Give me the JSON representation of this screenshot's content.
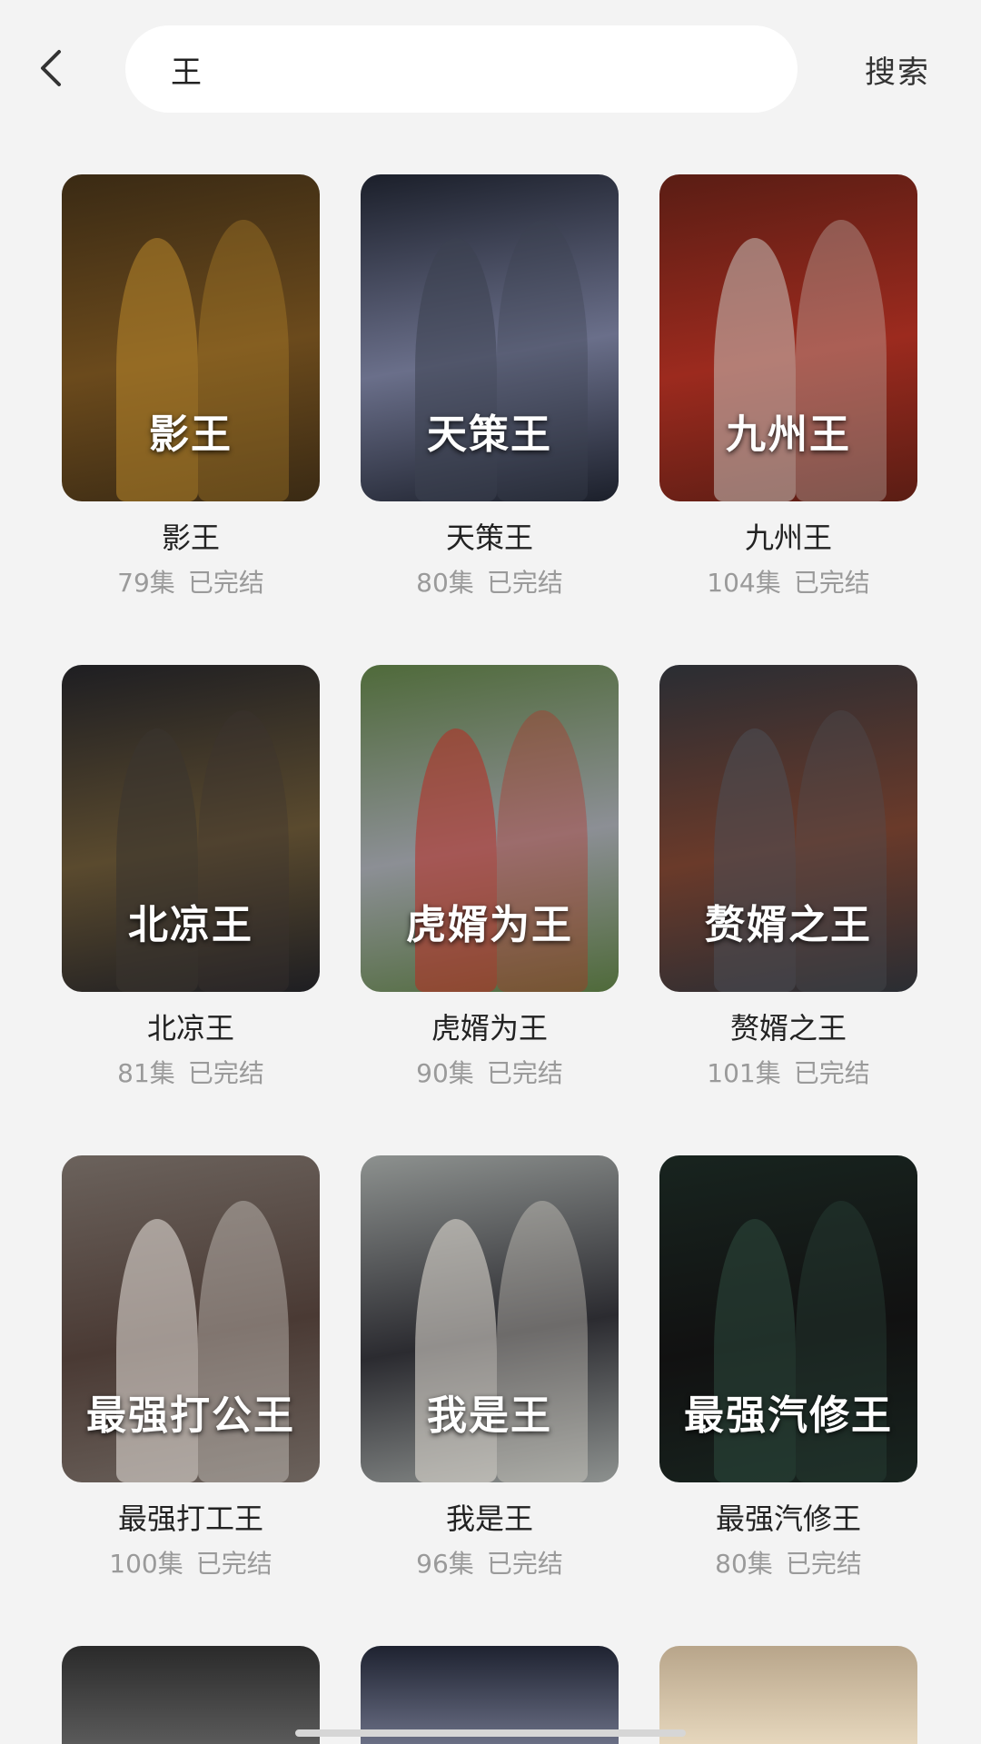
{
  "header": {
    "back_icon": "chevron-left-icon",
    "search_value": "王",
    "search_button_label": "搜索"
  },
  "results": [
    {
      "title": "影王",
      "episodes": "79集",
      "status": "已完结",
      "poster_text": "影王",
      "colors": [
        "#3a2a14",
        "#b8862c",
        "#6b4a1c"
      ]
    },
    {
      "title": "天策王",
      "episodes": "80集",
      "status": "已完结",
      "poster_text": "天策王",
      "colors": [
        "#1b1f2a",
        "#3c4250",
        "#6a6f8a"
      ]
    },
    {
      "title": "九州王",
      "episodes": "104集",
      "status": "已完结",
      "poster_text": "九州王",
      "colors": [
        "#5a1d14",
        "#c9c3bd",
        "#9c2a1e"
      ]
    },
    {
      "title": "北凉王",
      "episodes": "81集",
      "status": "已完结",
      "poster_text": "北凉王",
      "colors": [
        "#1e1e22",
        "#3b3530",
        "#5a4a2e"
      ]
    },
    {
      "title": "虎婿为王",
      "episodes": "90集",
      "status": "已完结",
      "poster_text": "虎婿为王",
      "colors": [
        "#4f6a3a",
        "#b92a20",
        "#8c8f95"
      ]
    },
    {
      "title": "赘婿之王",
      "episodes": "101集",
      "status": "已完结",
      "poster_text": "赘婿之王",
      "colors": [
        "#2a2d33",
        "#4d4f55",
        "#6a3a2a"
      ]
    },
    {
      "title": "最强打工王",
      "episodes": "100集",
      "status": "已完结",
      "poster_text": "最强打公王",
      "colors": [
        "#6b625c",
        "#e9e4df",
        "#4a3a34"
      ]
    },
    {
      "title": "我是王",
      "episodes": "96集",
      "status": "已完结",
      "poster_text": "我是王",
      "colors": [
        "#8d918f",
        "#e8e2d8",
        "#2b2b30"
      ]
    },
    {
      "title": "最强汽修王",
      "episodes": "80集",
      "status": "已完结",
      "poster_text": "最强汽修王",
      "colors": [
        "#18241f",
        "#2e4a3e",
        "#111111"
      ]
    }
  ],
  "partial_row": [
    {
      "colors": [
        "#2a2a2a",
        "#5a5a5a"
      ]
    },
    {
      "colors": [
        "#1e2230",
        "#6a6f85"
      ]
    },
    {
      "colors": [
        "#b8a58a",
        "#e6d7bd"
      ]
    }
  ]
}
